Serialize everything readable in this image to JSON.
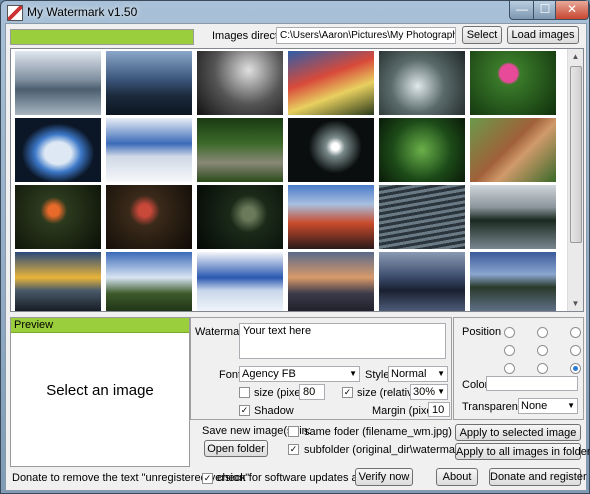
{
  "window": {
    "title": "My Watermark v1.50",
    "min": "—",
    "max": "☐",
    "close": "✕"
  },
  "toolbar": {
    "images_directory_label": "Images directory",
    "directory_value": "C:\\Users\\Aaron\\Pictures\\My Photography\\Alaska",
    "select_label": "Select",
    "load_images_label": "Load images",
    "progress_fraction": 1.0
  },
  "gallery": {
    "rows": 4,
    "cols": 6
  },
  "preview": {
    "header": "Preview",
    "message": "Select an image"
  },
  "watermark": {
    "label": "Watermark",
    "text": "Your text here",
    "font_label": "Font",
    "font_value": "Agency FB",
    "style_label": "Style",
    "style_value": "Normal",
    "size_pixel_label": "size (pixel)",
    "size_pixel_value": "80",
    "size_relative_label": "size (relative)",
    "size_relative_value": "30%",
    "shadow_label": "Shadow",
    "margin_label": "Margin (pixel)",
    "margin_value": "10"
  },
  "position": {
    "label": "Position",
    "selected": 8,
    "color_label": "Color",
    "transparency_label": "Transparency",
    "transparency_value": "None"
  },
  "save": {
    "label": "Save new image(s) in:",
    "open_folder_label": "Open folder",
    "same_folder_label": "same foder (filename_wm.jpg)",
    "subfolder_label": "subfolder (original_dir\\watermark)",
    "apply_selected_label": "Apply to selected image",
    "apply_all_label": "Apply to all images in folder"
  },
  "footer": {
    "donate_text": "Donate to remove the text \"unregistered version\"",
    "check_updates_label": "check for software updates at startup",
    "verify_label": "Verify now",
    "about_label": "About",
    "donate_register_label": "Donate and register"
  }
}
